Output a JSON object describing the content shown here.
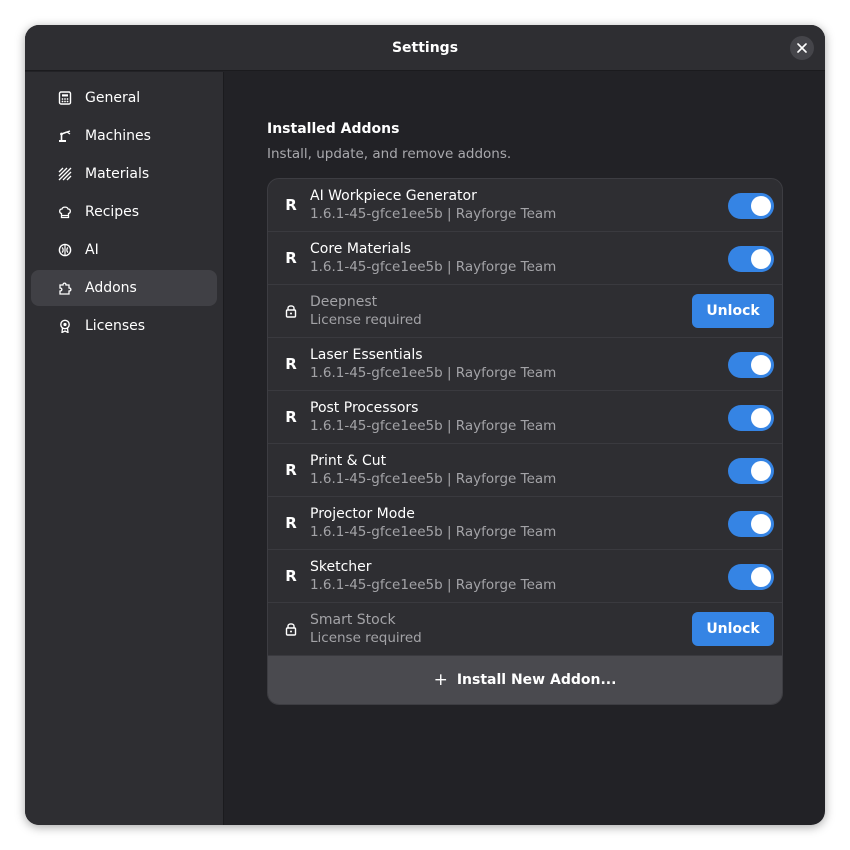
{
  "window": {
    "title": "Settings",
    "close_icon": "close-icon"
  },
  "sidebar": {
    "items": [
      {
        "label": "General",
        "icon": "calculator-icon",
        "active": false
      },
      {
        "label": "Machines",
        "icon": "robot-arm-icon",
        "active": false
      },
      {
        "label": "Materials",
        "icon": "hatch-pattern-icon",
        "active": false
      },
      {
        "label": "Recipes",
        "icon": "chef-hat-icon",
        "active": false
      },
      {
        "label": "AI",
        "icon": "brain-icon",
        "active": false
      },
      {
        "label": "Addons",
        "icon": "puzzle-piece-icon",
        "active": true
      },
      {
        "label": "Licenses",
        "icon": "certificate-icon",
        "active": false
      }
    ]
  },
  "main": {
    "title": "Installed Addons",
    "subtitle": "Install, update, and remove addons.",
    "addons": [
      {
        "name": "AI Workpiece Generator",
        "meta": "1.6.1-45-gfce1ee5b | Rayforge Team",
        "icon_glyph": "R",
        "enabled": true
      },
      {
        "name": "Core Materials",
        "meta": "1.6.1-45-gfce1ee5b | Rayforge Team",
        "icon_glyph": "R",
        "enabled": true
      },
      {
        "name": "Deepnest",
        "meta": "License required",
        "locked": true,
        "action_label": "Unlock"
      },
      {
        "name": "Laser Essentials",
        "meta": "1.6.1-45-gfce1ee5b | Rayforge Team",
        "icon_glyph": "R",
        "enabled": true
      },
      {
        "name": "Post Processors",
        "meta": "1.6.1-45-gfce1ee5b | Rayforge Team",
        "icon_glyph": "R",
        "enabled": true
      },
      {
        "name": "Print & Cut",
        "meta": "1.6.1-45-gfce1ee5b | Rayforge Team",
        "icon_glyph": "R",
        "enabled": true
      },
      {
        "name": "Projector Mode",
        "meta": "1.6.1-45-gfce1ee5b | Rayforge Team",
        "icon_glyph": "R",
        "enabled": true
      },
      {
        "name": "Sketcher",
        "meta": "1.6.1-45-gfce1ee5b | Rayforge Team",
        "icon_glyph": "R",
        "enabled": true
      },
      {
        "name": "Smart Stock",
        "meta": "License required",
        "locked": true,
        "action_label": "Unlock"
      }
    ],
    "install_label": "Install New Addon...",
    "install_glyph": "+"
  },
  "colors": {
    "accent": "#3584e4",
    "window_bg": "#222226",
    "sidebar_bg": "#2e2e32"
  }
}
